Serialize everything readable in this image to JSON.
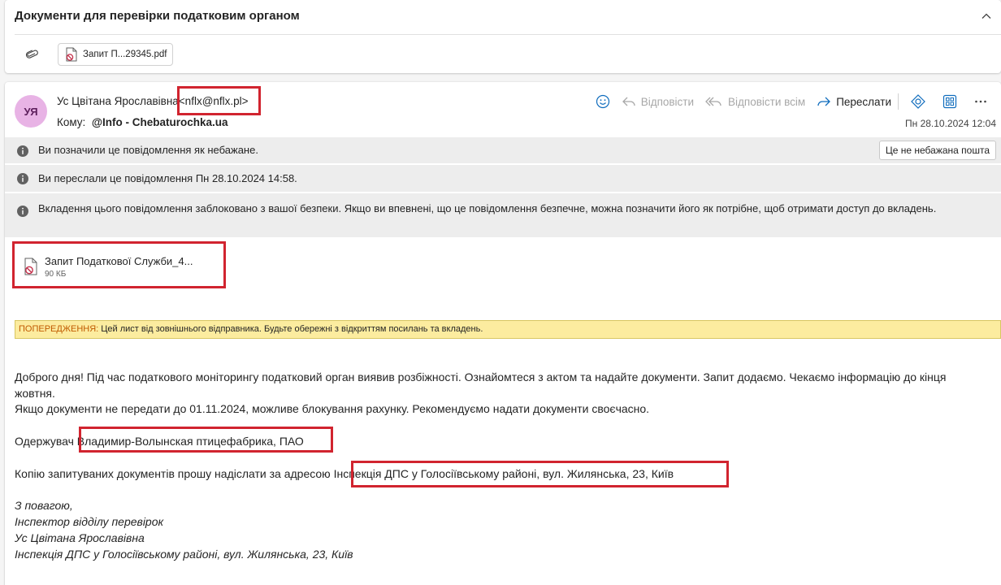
{
  "thread": {
    "subject": "Документи для перевірки податковим органом",
    "attachment_name": "Запит П...29345.pdf"
  },
  "message": {
    "avatar_initials": "УЯ",
    "avatar_color": "#e8b3e5",
    "sender_name": "Ус Цвітана Ярославівна",
    "sender_email": "<nflx@nflx.pl>",
    "to_label": "Кому:",
    "to_value": "@Info - Chebaturochka.ua",
    "date": "Пн 28.10.2024 12:04",
    "toolbar": {
      "reply": "Відповісти",
      "reply_all": "Відповісти всім",
      "forward": "Переслати"
    },
    "info_bars": {
      "junk": "Ви позначили це повідомлення як небажане.",
      "not_junk_button": "Це не небажана пошта",
      "forwarded": "Ви переслали це повідомлення Пн 28.10.2024 14:58.",
      "blocked": "Вкладення цього повідомлення заблоковано з вашої безпеки. Якщо ви впевнені, що це повідомлення безпечне, можна позначити його як потрібне, щоб отримати доступ до вкладень."
    },
    "attachment": {
      "name": "Запит Податкової Служби_4...",
      "size": "90 КБ"
    },
    "warning": {
      "label": "ПОПЕРЕДЖЕННЯ:",
      "text": " Цей лист від зовнішнього відправника. Будьте обережні з відкриттям посилань та вкладень."
    },
    "body": {
      "paragraph1": "Доброго дня! Під час податкового моніторингу податковий орган виявив розбіжності. Ознайомтеся з актом та надайте документи. Запит додаємо. Чекаємо інформацію до кінця жовтня.",
      "paragraph2": "Якщо документи не передати до 01.11.2024, можливе блокування рахунку. Рекомендуємо надати документи своєчасно.",
      "recipient_label": "Одержувач",
      "recipient_value": "Владимир-Волынская птицефабрика, ПАО",
      "address_label": "Копію запитуваних документів прошу надіслати за адресою",
      "address_value": "Інспекція ДПС у Голосіївському районі, вул. Жилянська, 23, Київ"
    },
    "signature": {
      "line1": "З повагою,",
      "line2": "Інспектор відділу перевірок",
      "line3": "Ус Цвітана Ярославівна",
      "line4": "Інспекція ДПС у Голосіївському районі, вул. Жилянська, 23, Київ"
    }
  },
  "colors": {
    "highlight": "#d1242f",
    "accent": "#0f6cbd",
    "warning_bg": "#fcec9f",
    "info_bar_bg": "#ededed"
  }
}
